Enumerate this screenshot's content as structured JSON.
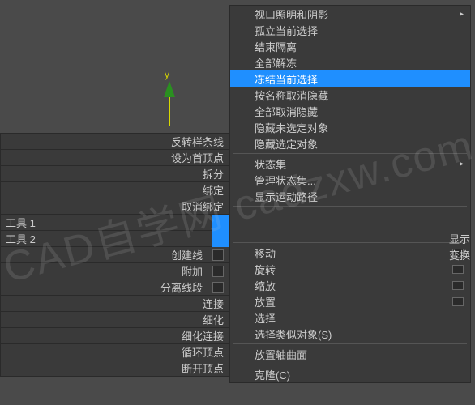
{
  "gizmo": {
    "axis_label": "y"
  },
  "left_panel": {
    "rows": [
      {
        "label": "反转样条线"
      },
      {
        "label": "设为首顶点"
      }
    ],
    "fold_rows": [
      {
        "label": "拆分"
      },
      {
        "label": "绑定"
      },
      {
        "label": "取消绑定"
      }
    ],
    "tool_rows": [
      {
        "label": "工具 1"
      },
      {
        "label": "工具 2"
      }
    ],
    "action_rows": [
      {
        "label": "创建线"
      },
      {
        "label": "附加"
      },
      {
        "label": "分离线段"
      },
      {
        "label": "连接"
      },
      {
        "label": "细化"
      },
      {
        "label": "细化连接"
      }
    ],
    "cycle_rows": [
      {
        "label": "循环顶点"
      },
      {
        "label": "断开顶点"
      }
    ]
  },
  "right_labels": {
    "display": "显示",
    "transform": "变换"
  },
  "context_menu": {
    "group1": [
      {
        "label": "视口照明和阴影",
        "submenu": true
      },
      {
        "label": "孤立当前选择"
      },
      {
        "label": "结束隔离"
      },
      {
        "label": "全部解冻"
      },
      {
        "label": "冻结当前选择",
        "highlighted": true
      },
      {
        "label": "按名称取消隐藏"
      },
      {
        "label": "全部取消隐藏"
      },
      {
        "label": "隐藏未选定对象"
      },
      {
        "label": "隐藏选定对象"
      }
    ],
    "group2": [
      {
        "label": "状态集",
        "submenu": true
      },
      {
        "label": "管理状态集..."
      },
      {
        "label": "显示运动路径"
      }
    ],
    "spacer_count": 2,
    "group3": [
      {
        "label": "移动",
        "checkbox": true
      },
      {
        "label": "旋转",
        "checkbox": true
      },
      {
        "label": "缩放",
        "checkbox": true
      },
      {
        "label": "放置",
        "checkbox": true
      },
      {
        "label": "选择"
      },
      {
        "label": "选择类似对象(S)"
      }
    ],
    "group4": [
      {
        "label": "放置轴曲面"
      }
    ],
    "group5": [
      {
        "label": "克隆(C)"
      }
    ]
  },
  "watermark": "CAD自学网 cadzxw.com"
}
